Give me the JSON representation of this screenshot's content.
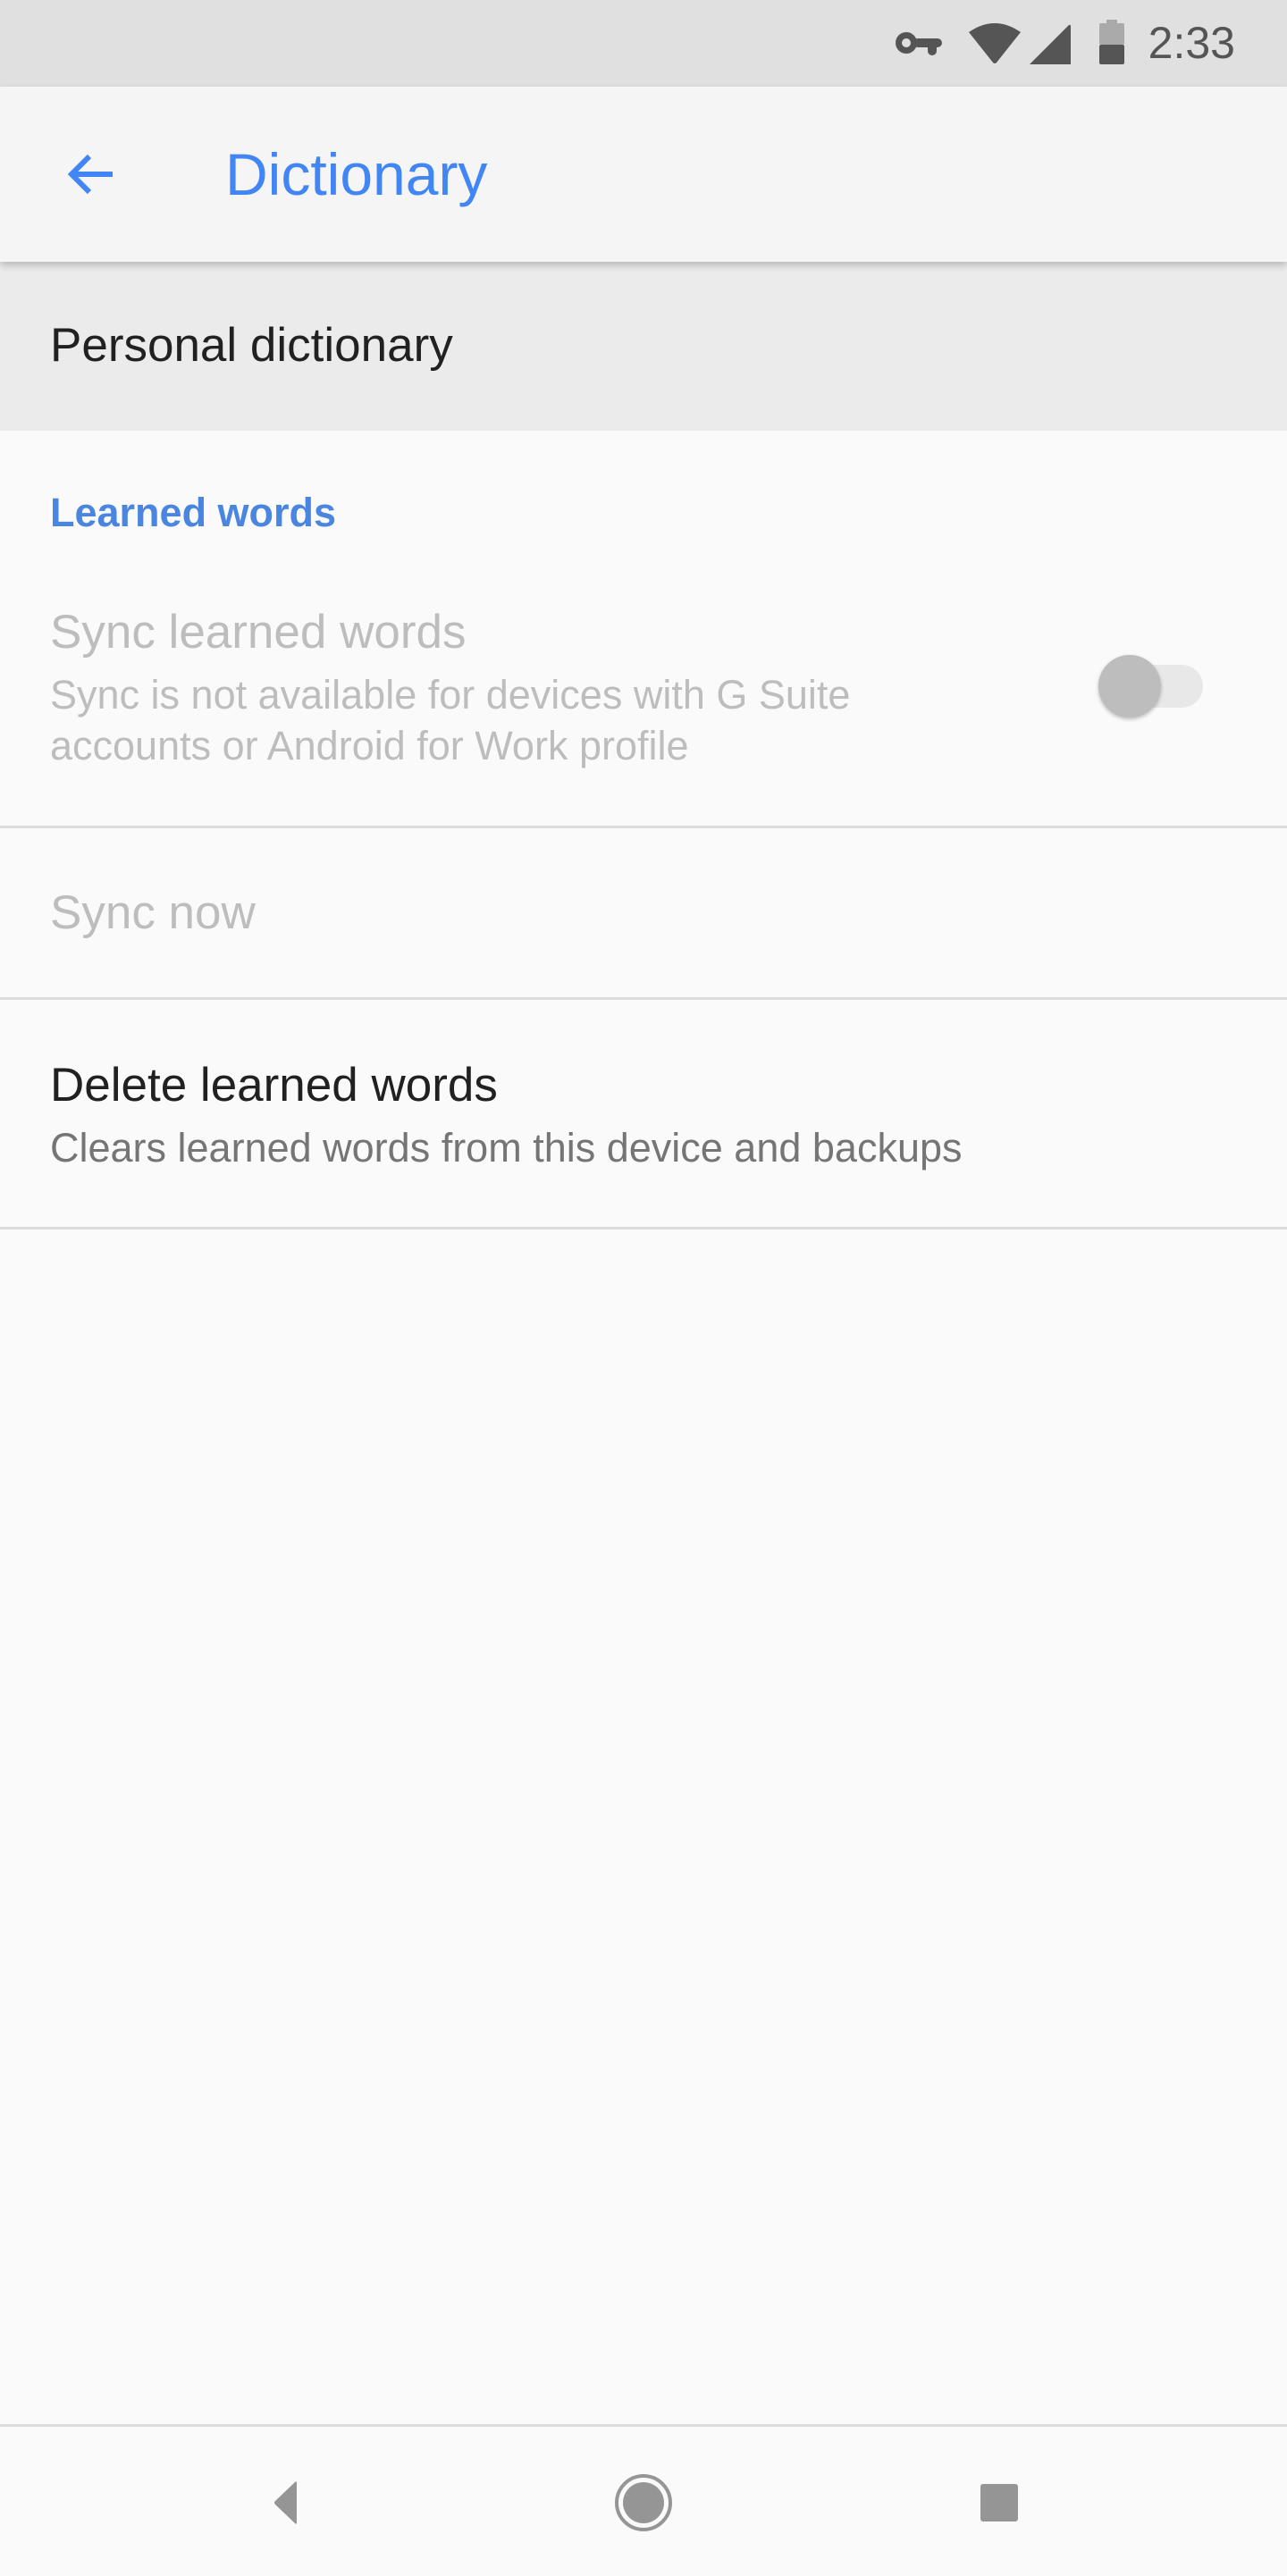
{
  "status_bar": {
    "time": "2:33",
    "icons": [
      "vpn-key-icon",
      "wifi-icon",
      "cell-signal-icon",
      "battery-icon"
    ]
  },
  "app_bar": {
    "back_icon": "arrow-left-icon",
    "title": "Dictionary"
  },
  "items": {
    "personal_dictionary": {
      "label": "Personal dictionary"
    },
    "category": {
      "label": "Learned words"
    },
    "sync_learned_words": {
      "title": "Sync learned words",
      "summary": "Sync is not available for devices with G Suite accounts or Android for Work profile",
      "enabled": false,
      "checked": false
    },
    "sync_now": {
      "title": "Sync now",
      "enabled": false
    },
    "delete_learned_words": {
      "title": "Delete learned words",
      "summary": "Clears learned words from this device and backups"
    }
  },
  "nav_bar": {
    "buttons": [
      "back-icon",
      "home-icon",
      "recents-icon"
    ]
  },
  "colors": {
    "accent": "#4285f4",
    "status_bar": "#e0e0e0",
    "app_bar": "#f5f5f5",
    "background": "#fafafa",
    "disabled_text": "#bdbdbd"
  }
}
